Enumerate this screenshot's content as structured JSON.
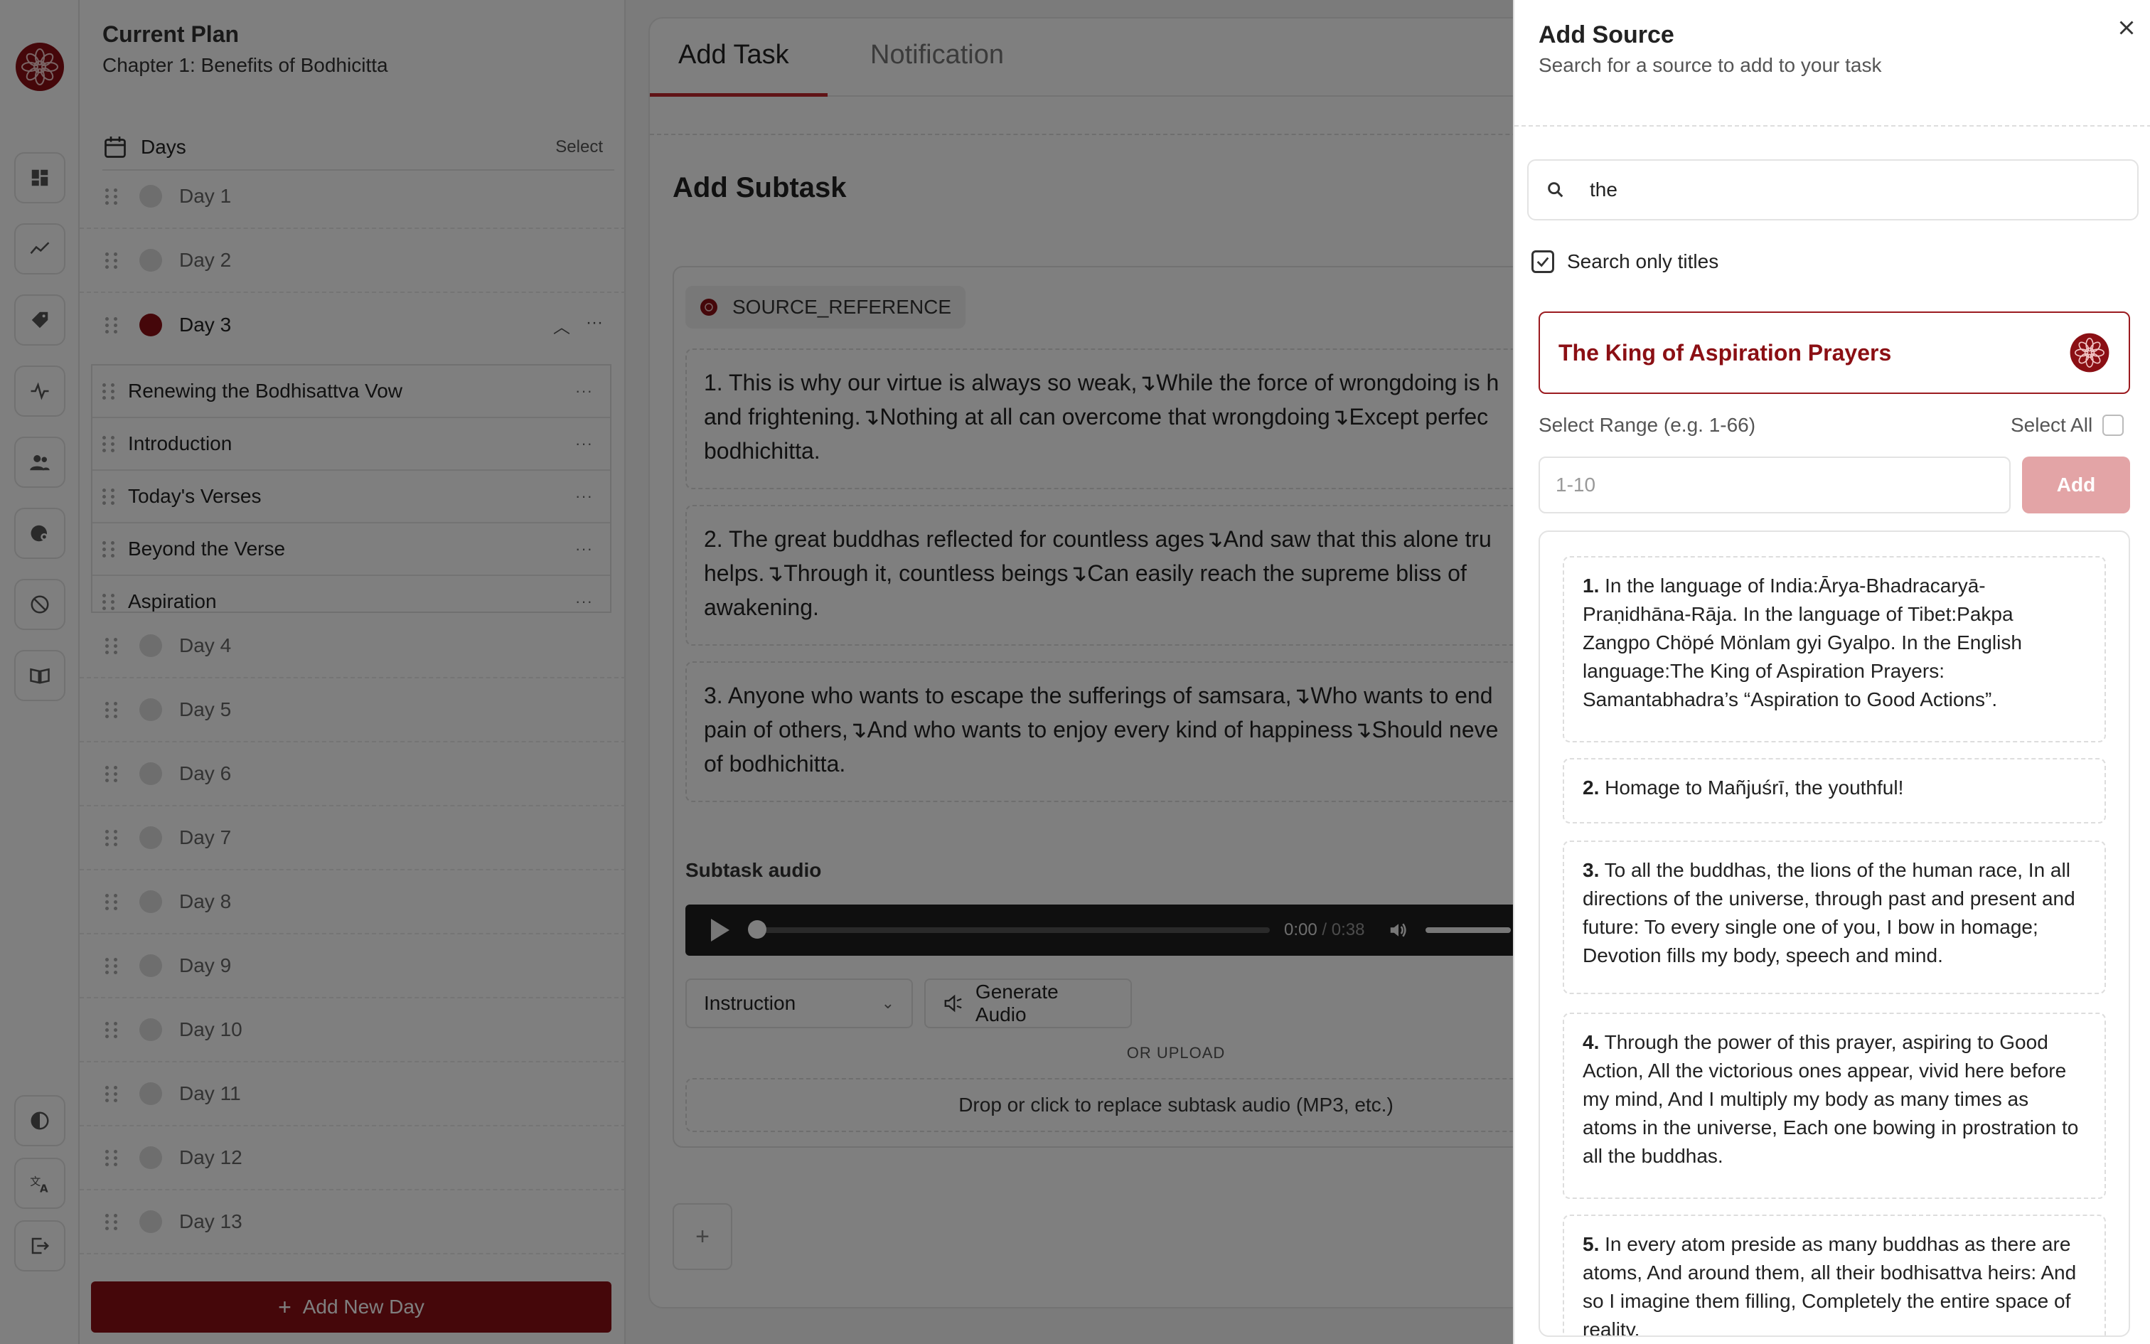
{
  "plan": {
    "title": "Current Plan",
    "chapter": "Chapter 1: Benefits of Bodhicitta"
  },
  "days_header": {
    "label": "Days",
    "select_label": "Select"
  },
  "days": [
    {
      "label": "Day 1",
      "active": false
    },
    {
      "label": "Day 2",
      "active": false
    },
    {
      "label": "Day 3",
      "active": true
    },
    {
      "label": "Day 4",
      "active": false
    },
    {
      "label": "Day 5",
      "active": false
    },
    {
      "label": "Day 6",
      "active": false
    },
    {
      "label": "Day 7",
      "active": false
    },
    {
      "label": "Day 8",
      "active": false
    },
    {
      "label": "Day 9",
      "active": false
    },
    {
      "label": "Day 10",
      "active": false
    },
    {
      "label": "Day 11",
      "active": false
    },
    {
      "label": "Day 12",
      "active": false
    },
    {
      "label": "Day 13",
      "active": false
    }
  ],
  "day3_tasks": [
    "Renewing the Bodhisattva Vow",
    "Introduction",
    "Today's Verses",
    "Beyond the Verse",
    "Aspiration"
  ],
  "add_day_label": "Add New Day",
  "tabs": {
    "add_task": "Add Task",
    "notification": "Notification"
  },
  "subtask": {
    "title": "Add Subtask",
    "source_chip": "SOURCE_REFERENCE",
    "verses": [
      {
        "line1": "1. This is why our virtue is always so weak,↴While the force of wrongdoing is h",
        "line2": "and frightening.↴Nothing at all can overcome that wrongdoing↴Except perfec",
        "line3": "bodhichitta."
      },
      {
        "line1": "2. The great buddhas reflected for countless ages↴And saw that this alone tru",
        "line2": "helps.↴Through it, countless beings↴Can easily reach the supreme bliss of",
        "line3": "awakening."
      },
      {
        "line1": "3. Anyone who wants to escape the sufferings of samsara,↴Who wants to end",
        "line2": "pain of others,↴And who wants to enjoy every kind of happiness↴Should neve",
        "line3": "of bodhichitta."
      }
    ],
    "audio_label": "Subtask audio",
    "audio_time": "0:00",
    "audio_duration": " / 0:38",
    "audio_progress": 0,
    "instruction_value": "Instruction",
    "generate_label": "Generate Audio",
    "or_upload": "OR UPLOAD",
    "drop_label": "Drop or click to replace subtask audio (MP3, etc.)",
    "add_plus": "+"
  },
  "drawer": {
    "title": "Add Source",
    "subtitle": "Search for a source to add to your task",
    "search_value": "the",
    "checkbox_label": "Search only titles",
    "checkbox_checked": true,
    "source_name": "The King of Aspiration Prayers",
    "range_label": "Select Range (e.g. 1-66)",
    "select_all": "Select All",
    "range_placeholder": "1-10",
    "add_label": "Add",
    "verses": [
      {
        "num": "1.",
        "text": " In the language of India:Ārya-Bhadracaryā-Praṇidhāna-Rāja. In the language of Tibet:Pakpa Zangpo Chöpé Mönlam gyi Gyalpo. In the English language:The King of Aspiration Prayers: Samantabhadra’s “Aspiration to Good Actions”."
      },
      {
        "num": "2.",
        "text": " Homage to Mañjuśrī, the youthful!"
      },
      {
        "num": "3.",
        "text": " To all the buddhas, the lions of the human race, In all directions of the universe, through past and present and future: To every single one of you, I bow in homage; Devotion fills my body, speech and mind."
      },
      {
        "num": "4.",
        "text": " Through the power of this prayer, aspiring to Good Action, All the victorious ones appear, vivid here before my mind, And I multiply my body as many times as atoms in the universe, Each one bowing in prostration to all the buddhas."
      },
      {
        "num": "5.",
        "text": " In every atom preside as many buddhas as there are atoms, And around them, all their bodhisattva heirs: And so I imagine them filling, Completely the entire space of reality."
      }
    ]
  },
  "colors": {
    "brand": "#8b0f14",
    "accent_red": "#c0262c",
    "add_disabled": "#e3a4a6"
  }
}
